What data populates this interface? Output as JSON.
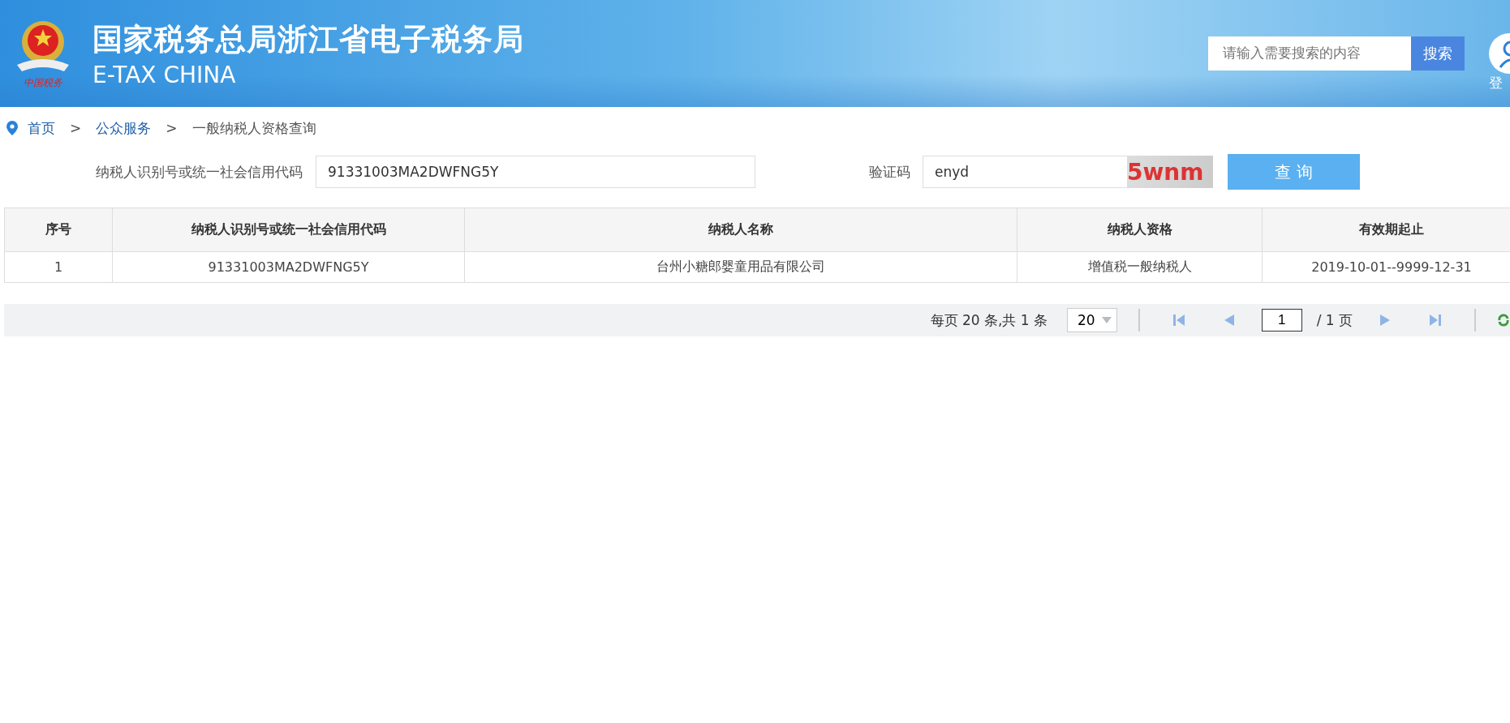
{
  "header": {
    "title": "国家税务总局浙江省电子税务局",
    "subtitle": "E-TAX CHINA",
    "emblem_caption": "中国税务",
    "search": {
      "placeholder": "请输入需要搜索的内容",
      "button": "搜索"
    },
    "login": "登"
  },
  "breadcrumb": [
    {
      "label": "首页",
      "link": true
    },
    {
      "label": "公众服务",
      "link": true
    },
    {
      "label": "一般纳税人资格查询",
      "link": false
    }
  ],
  "breadcrumb_separator": ">",
  "form": {
    "id_label": "纳税人识别号或统一社会信用代码",
    "id_value": "91331003MA2DWFNG5Y",
    "captcha_label": "验证码",
    "captcha_value": "enyd",
    "captcha_image": "5wnm",
    "submit": "查 询"
  },
  "table": {
    "columns": [
      "序号",
      "纳税人识别号或统一社会信用代码",
      "纳税人名称",
      "纳税人资格",
      "有效期起止"
    ],
    "rows": [
      [
        "1",
        "91331003MA2DWFNG5Y",
        "台州小糖郎婴童用品有限公司",
        "增值税一般纳税人",
        "2019-10-01--9999-12-31"
      ]
    ]
  },
  "pagination": {
    "summary": "每页 20 条,共 1 条",
    "page_size": "20",
    "page": "1",
    "total_pages": "/ 1 页"
  }
}
